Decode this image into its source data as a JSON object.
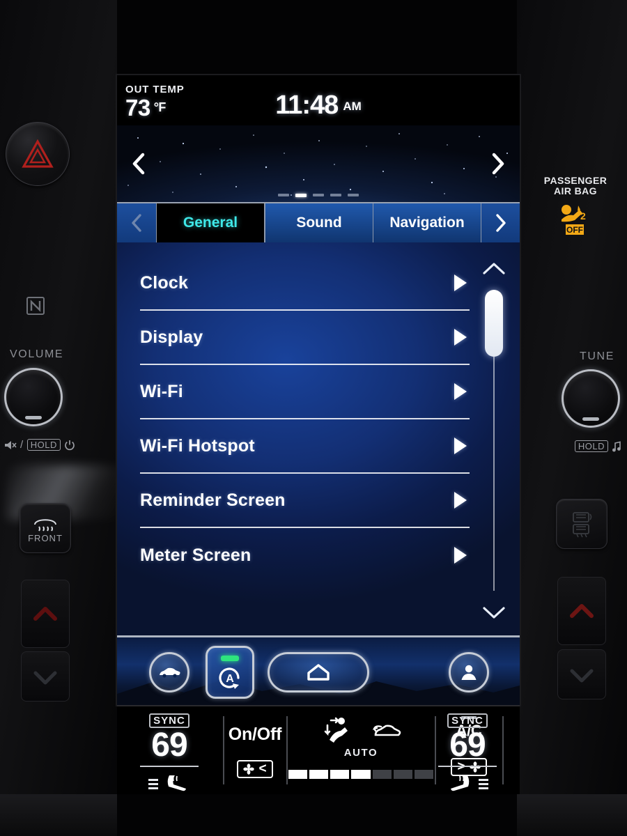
{
  "screen": {
    "status": {
      "out_temp_label": "OUT TEMP",
      "out_temp_value": "73",
      "out_temp_unit": "°F",
      "clock_time": "11:48",
      "clock_ampm": "AM"
    },
    "carousel": {
      "prev_icon": "chevron-left-icon",
      "next_icon": "chevron-right-icon",
      "page_count": 5,
      "active_page": 2
    },
    "tabs": {
      "prev_icon": "chevron-left-icon",
      "next_icon": "chevron-right-icon",
      "items": [
        {
          "label": "General",
          "active": true
        },
        {
          "label": "Sound",
          "active": false
        },
        {
          "label": "Navigation",
          "active": false
        }
      ]
    },
    "list": {
      "items": [
        {
          "label": "Clock"
        },
        {
          "label": "Display"
        },
        {
          "label": "Wi-Fi"
        },
        {
          "label": "Wi-Fi Hotspot"
        },
        {
          "label": "Reminder Screen"
        },
        {
          "label": "Meter Screen"
        }
      ],
      "scroll_up_icon": "chevron-up-icon",
      "scroll_down_icon": "chevron-down-icon"
    },
    "dock": {
      "vehicle_icon": "car-icon",
      "auto_stop_icon": "auto-start-stop-icon",
      "auto_stop_led": "#2EE57E",
      "home_icon": "home-icon",
      "profile_icon": "person-icon"
    }
  },
  "climate": {
    "driver": {
      "sync_label": "SYNC",
      "temp": "69",
      "seat_icon": "heated-seat-icon"
    },
    "passenger": {
      "sync_label": "SYNC",
      "temp": "69",
      "seat_icon": "heated-seat-icon"
    },
    "power_label": "On/Off",
    "mode_icon": "airflow-mode-icon",
    "recirc_icon": "air-recirculation-icon",
    "auto_label": "AUTO",
    "ac_label": "A/C",
    "fan_down_label": "<",
    "fan_up_label": ">",
    "fan_icon": "fan-icon",
    "fan_segments_total": 7,
    "fan_segments_on": 4
  },
  "bezel": {
    "left": {
      "hazard_icon": "hazard-warning-icon",
      "nfc_icon": "nfc-icon",
      "volume_label": "VOLUME",
      "volume_knob": "volume-knob",
      "mute_icon": "mute-icon",
      "sub_separator": "/",
      "hold_label": "HOLD",
      "power_icon": "power-icon",
      "defrost_front_icon": "front-defroster-icon",
      "defrost_front_label": "FRONT",
      "temp_up_icon": "temp-up-arrow-icon"
    },
    "right": {
      "airbag_title_line1": "PASSENGER",
      "airbag_title_line2": "AIR BAG",
      "airbag_status": "OFF",
      "airbag_icon": "passenger-airbag-off-icon",
      "airbag_color": "#F2A816",
      "tune_label": "TUNE",
      "tune_knob": "tune-knob",
      "hold_label": "HOLD",
      "music_icon": "music-note-icon",
      "defrost_rear_icon": "rear-defroster-icon",
      "temp_up_icon": "temp-up-arrow-icon"
    }
  }
}
